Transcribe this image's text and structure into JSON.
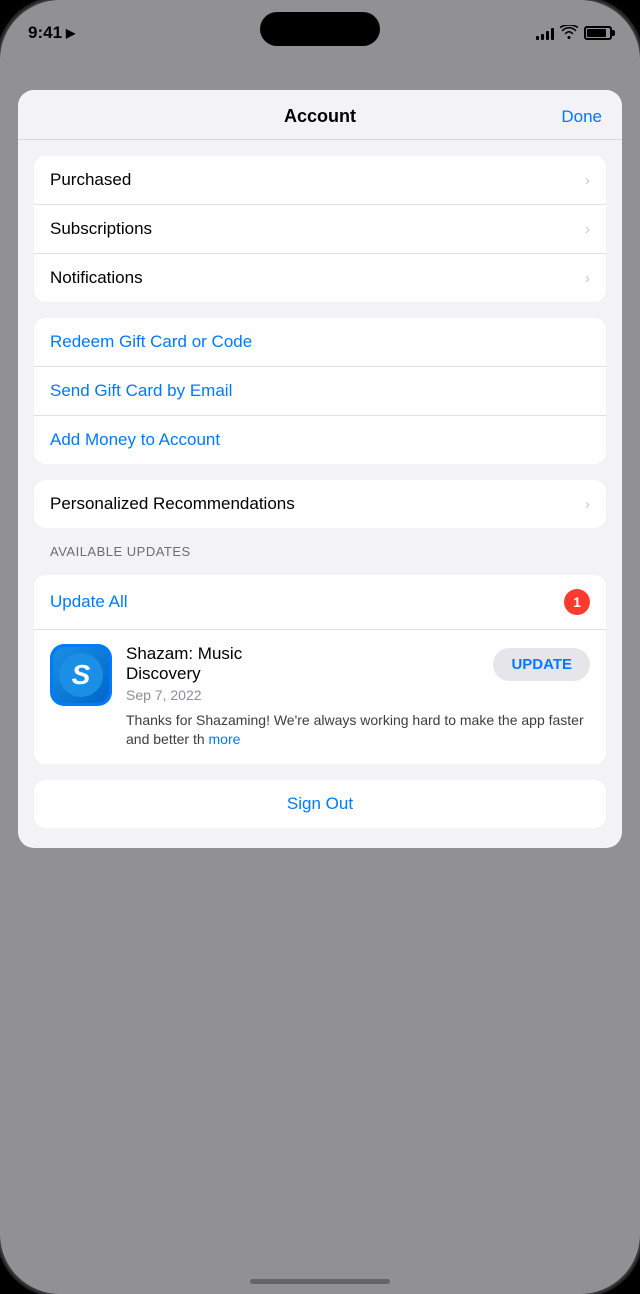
{
  "status_bar": {
    "time": "9:41",
    "location_icon": "◀",
    "signal_bars": [
      4,
      6,
      8,
      10,
      12
    ],
    "wifi": "wifi",
    "battery_percent": 85
  },
  "modal": {
    "title": "Account",
    "done_label": "Done"
  },
  "section1": {
    "items": [
      {
        "label": "Purchased",
        "has_chevron": true
      },
      {
        "label": "Subscriptions",
        "has_chevron": true
      },
      {
        "label": "Notifications",
        "has_chevron": true
      }
    ]
  },
  "section2": {
    "items": [
      {
        "label": "Redeem Gift Card or Code",
        "blue": true
      },
      {
        "label": "Send Gift Card by Email",
        "blue": true
      },
      {
        "label": "Add Money to Account",
        "blue": true
      }
    ]
  },
  "section3": {
    "items": [
      {
        "label": "Personalized Recommendations",
        "has_chevron": true
      }
    ]
  },
  "updates": {
    "section_label": "AVAILABLE UPDATES",
    "update_all_label": "Update All",
    "badge_count": "1",
    "app": {
      "name": "Shazam: Music\nDiscovery",
      "date": "Sep 7, 2022",
      "description": "Thanks for Shazaming! We're always working hard to make the app faster and better th",
      "more_label": "more",
      "update_label": "UPDATE"
    }
  },
  "sign_out": {
    "label": "Sign Out"
  }
}
